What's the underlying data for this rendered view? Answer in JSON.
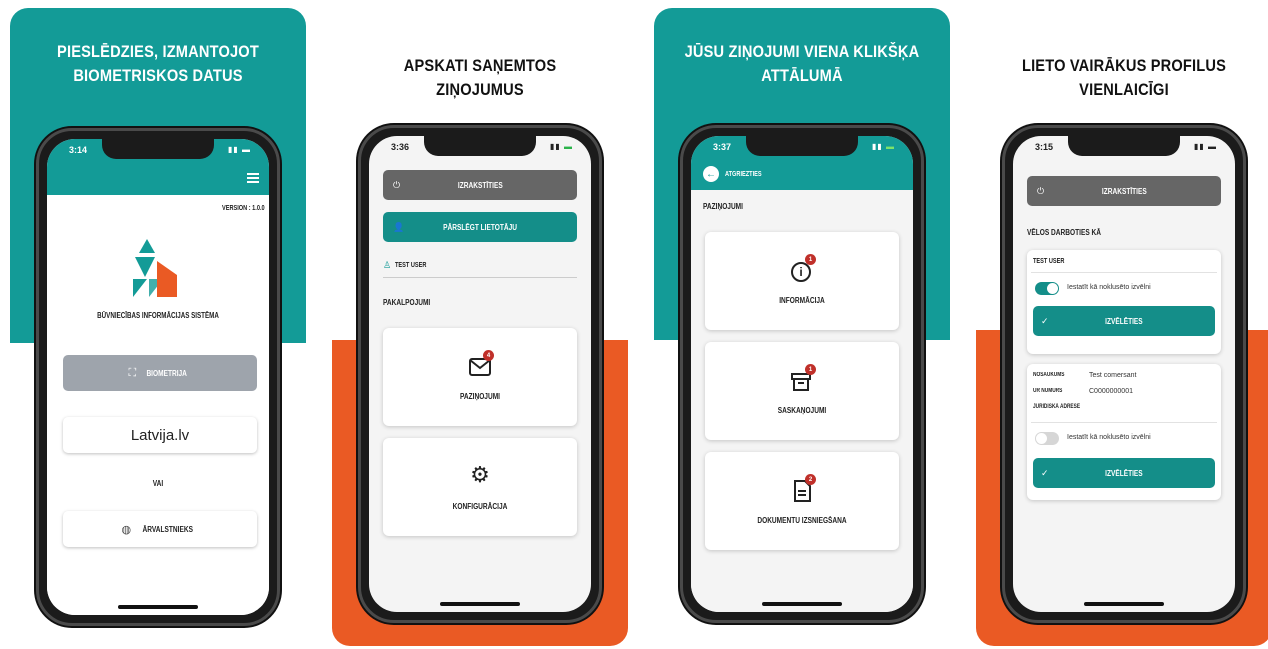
{
  "panels": [
    {
      "headline_line1": "PIESLĒDZIES, IZMANTOJOT",
      "headline_line2": "BIOMETRISKOS DATUS",
      "time": "3:14",
      "version": "VERSION : 1.0.0",
      "app_name": "BŪVNIECĪBAS INFORMĀCIJAS SISTĒMA",
      "biometry_label": "BIOMETRIJA",
      "latvija_label": "Latvija.lv",
      "or_label": "VAI",
      "foreigner_label": "ĀRVALSTNIEKS"
    },
    {
      "headline": "APSKATI SAŅEMTOS ZIŅOJUMUS",
      "time": "3:36",
      "logout_label": "IZRAKSTĪTIES",
      "switch_user_label": "PĀRSLĒGT LIETOTĀJU",
      "user_name": "TEST USER",
      "services_title": "PAKALPOJUMI",
      "tile_notifications": "PAZIŅOJUMI",
      "tile_notifications_badge": "4",
      "tile_config": "KONFIGURĀCIJA"
    },
    {
      "headline_line1": "JŪSU ZIŅOJUMI VIENA KLIKŠĶA",
      "headline_line2": "ATTĀLUMĀ",
      "time": "3:37",
      "back_label": "ATGRIEZTIES",
      "section_title": "PAZIŅOJUMI",
      "tile_info": "INFORMĀCIJA",
      "tile_info_badge": "1",
      "tile_approvals": "SASKAŅOJUMI",
      "tile_approvals_badge": "1",
      "tile_docs": "DOKUMENTU IZSNIEGŠANA",
      "tile_docs_badge": "2"
    },
    {
      "headline": "LIETO VAIRĀKUS PROFILUS VIENLAICĪGI",
      "time": "3:15",
      "logout_label": "IZRAKSTĪTIES",
      "act_as_title": "VĒLOS DARBOTIES KĀ",
      "profile1_name": "TEST USER",
      "default_toggle_label": "Iestatīt kā noklusēto izvēlni",
      "choose_label": "IZVĒLĒTIES",
      "field_name_label": "NOSAUKUMS",
      "field_name_value": "Test comersant",
      "field_reg_label": "UR NUMURS",
      "field_reg_value": "C0000000001",
      "field_address_label": "JURIDISKĀ ADRESE",
      "default_toggle_label2": "Iestatīt kā noklusēto izvēlni",
      "choose_label2": "IZVĒLĒTIES"
    }
  ],
  "colors": {
    "teal": "#139b97",
    "orange": "#ea5a24",
    "button_teal": "#148e89",
    "button_gray": "#666666",
    "badge_red": "#c0302a"
  }
}
